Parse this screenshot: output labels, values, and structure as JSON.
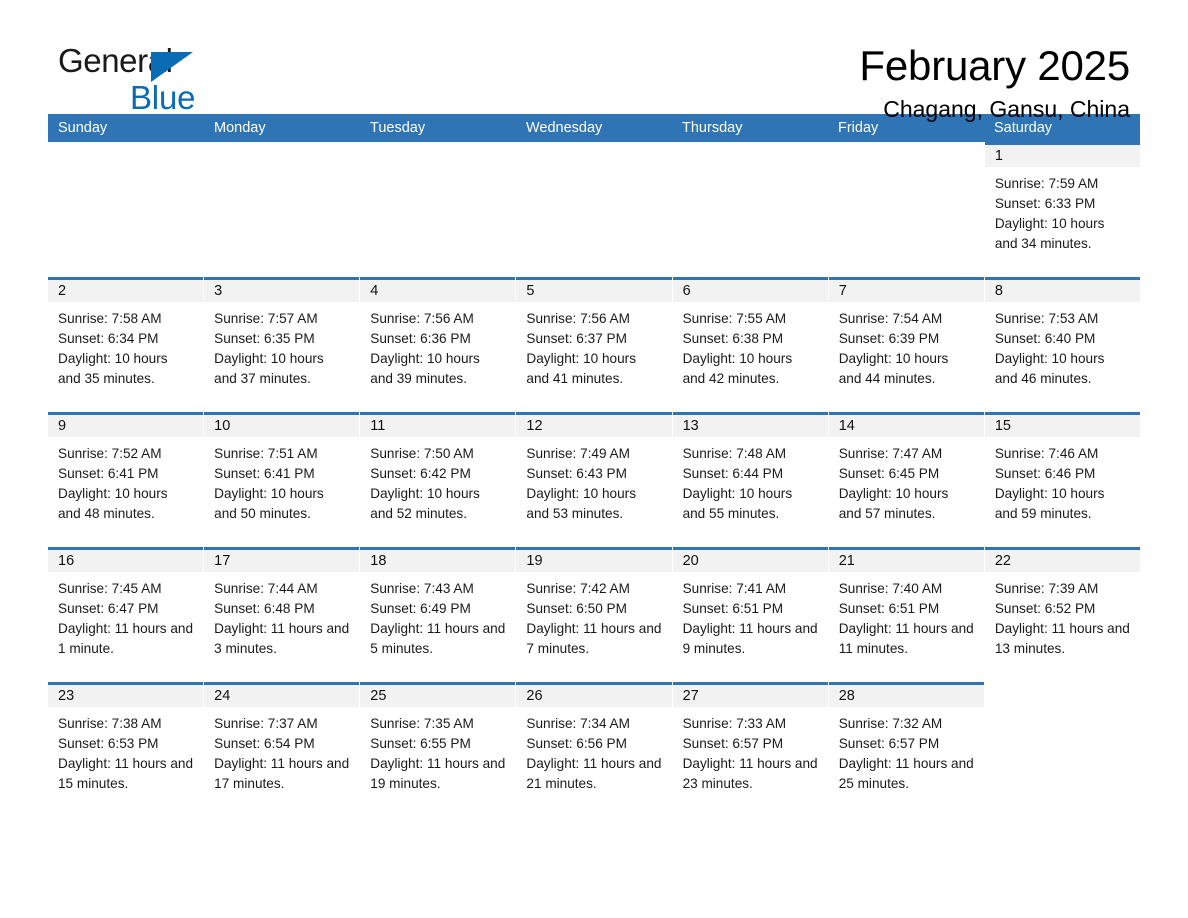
{
  "logo": {
    "word1": "General",
    "word2": "Blue",
    "triangle_color": "#0a6cb4"
  },
  "header": {
    "title": "February 2025",
    "location": "Chagang, Gansu, China"
  },
  "theme": {
    "header_blue": "#2f74b4",
    "daynum_band": "#f2f2f2",
    "text": "#1a1a1a"
  },
  "weekdays": [
    "Sunday",
    "Monday",
    "Tuesday",
    "Wednesday",
    "Thursday",
    "Friday",
    "Saturday"
  ],
  "weeks": [
    [
      {
        "state": "blank"
      },
      {
        "state": "blank"
      },
      {
        "state": "blank"
      },
      {
        "state": "blank"
      },
      {
        "state": "blank"
      },
      {
        "state": "blank"
      },
      {
        "state": "filled",
        "day": "1",
        "sunrise": "Sunrise: 7:59 AM",
        "sunset": "Sunset: 6:33 PM",
        "daylight": "Daylight: 10 hours and 34 minutes."
      }
    ],
    [
      {
        "state": "filled",
        "day": "2",
        "sunrise": "Sunrise: 7:58 AM",
        "sunset": "Sunset: 6:34 PM",
        "daylight": "Daylight: 10 hours and 35 minutes."
      },
      {
        "state": "filled",
        "day": "3",
        "sunrise": "Sunrise: 7:57 AM",
        "sunset": "Sunset: 6:35 PM",
        "daylight": "Daylight: 10 hours and 37 minutes."
      },
      {
        "state": "filled",
        "day": "4",
        "sunrise": "Sunrise: 7:56 AM",
        "sunset": "Sunset: 6:36 PM",
        "daylight": "Daylight: 10 hours and 39 minutes."
      },
      {
        "state": "filled",
        "day": "5",
        "sunrise": "Sunrise: 7:56 AM",
        "sunset": "Sunset: 6:37 PM",
        "daylight": "Daylight: 10 hours and 41 minutes."
      },
      {
        "state": "filled",
        "day": "6",
        "sunrise": "Sunrise: 7:55 AM",
        "sunset": "Sunset: 6:38 PM",
        "daylight": "Daylight: 10 hours and 42 minutes."
      },
      {
        "state": "filled",
        "day": "7",
        "sunrise": "Sunrise: 7:54 AM",
        "sunset": "Sunset: 6:39 PM",
        "daylight": "Daylight: 10 hours and 44 minutes."
      },
      {
        "state": "filled",
        "day": "8",
        "sunrise": "Sunrise: 7:53 AM",
        "sunset": "Sunset: 6:40 PM",
        "daylight": "Daylight: 10 hours and 46 minutes."
      }
    ],
    [
      {
        "state": "filled",
        "day": "9",
        "sunrise": "Sunrise: 7:52 AM",
        "sunset": "Sunset: 6:41 PM",
        "daylight": "Daylight: 10 hours and 48 minutes."
      },
      {
        "state": "filled",
        "day": "10",
        "sunrise": "Sunrise: 7:51 AM",
        "sunset": "Sunset: 6:41 PM",
        "daylight": "Daylight: 10 hours and 50 minutes."
      },
      {
        "state": "filled",
        "day": "11",
        "sunrise": "Sunrise: 7:50 AM",
        "sunset": "Sunset: 6:42 PM",
        "daylight": "Daylight: 10 hours and 52 minutes."
      },
      {
        "state": "filled",
        "day": "12",
        "sunrise": "Sunrise: 7:49 AM",
        "sunset": "Sunset: 6:43 PM",
        "daylight": "Daylight: 10 hours and 53 minutes."
      },
      {
        "state": "filled",
        "day": "13",
        "sunrise": "Sunrise: 7:48 AM",
        "sunset": "Sunset: 6:44 PM",
        "daylight": "Daylight: 10 hours and 55 minutes."
      },
      {
        "state": "filled",
        "day": "14",
        "sunrise": "Sunrise: 7:47 AM",
        "sunset": "Sunset: 6:45 PM",
        "daylight": "Daylight: 10 hours and 57 minutes."
      },
      {
        "state": "filled",
        "day": "15",
        "sunrise": "Sunrise: 7:46 AM",
        "sunset": "Sunset: 6:46 PM",
        "daylight": "Daylight: 10 hours and 59 minutes."
      }
    ],
    [
      {
        "state": "filled",
        "day": "16",
        "sunrise": "Sunrise: 7:45 AM",
        "sunset": "Sunset: 6:47 PM",
        "daylight": "Daylight: 11 hours and 1 minute."
      },
      {
        "state": "filled",
        "day": "17",
        "sunrise": "Sunrise: 7:44 AM",
        "sunset": "Sunset: 6:48 PM",
        "daylight": "Daylight: 11 hours and 3 minutes."
      },
      {
        "state": "filled",
        "day": "18",
        "sunrise": "Sunrise: 7:43 AM",
        "sunset": "Sunset: 6:49 PM",
        "daylight": "Daylight: 11 hours and 5 minutes."
      },
      {
        "state": "filled",
        "day": "19",
        "sunrise": "Sunrise: 7:42 AM",
        "sunset": "Sunset: 6:50 PM",
        "daylight": "Daylight: 11 hours and 7 minutes."
      },
      {
        "state": "filled",
        "day": "20",
        "sunrise": "Sunrise: 7:41 AM",
        "sunset": "Sunset: 6:51 PM",
        "daylight": "Daylight: 11 hours and 9 minutes."
      },
      {
        "state": "filled",
        "day": "21",
        "sunrise": "Sunrise: 7:40 AM",
        "sunset": "Sunset: 6:51 PM",
        "daylight": "Daylight: 11 hours and 11 minutes."
      },
      {
        "state": "filled",
        "day": "22",
        "sunrise": "Sunrise: 7:39 AM",
        "sunset": "Sunset: 6:52 PM",
        "daylight": "Daylight: 11 hours and 13 minutes."
      }
    ],
    [
      {
        "state": "filled",
        "day": "23",
        "sunrise": "Sunrise: 7:38 AM",
        "sunset": "Sunset: 6:53 PM",
        "daylight": "Daylight: 11 hours and 15 minutes."
      },
      {
        "state": "filled",
        "day": "24",
        "sunrise": "Sunrise: 7:37 AM",
        "sunset": "Sunset: 6:54 PM",
        "daylight": "Daylight: 11 hours and 17 minutes."
      },
      {
        "state": "filled",
        "day": "25",
        "sunrise": "Sunrise: 7:35 AM",
        "sunset": "Sunset: 6:55 PM",
        "daylight": "Daylight: 11 hours and 19 minutes."
      },
      {
        "state": "filled",
        "day": "26",
        "sunrise": "Sunrise: 7:34 AM",
        "sunset": "Sunset: 6:56 PM",
        "daylight": "Daylight: 11 hours and 21 minutes."
      },
      {
        "state": "filled",
        "day": "27",
        "sunrise": "Sunrise: 7:33 AM",
        "sunset": "Sunset: 6:57 PM",
        "daylight": "Daylight: 11 hours and 23 minutes."
      },
      {
        "state": "filled",
        "day": "28",
        "sunrise": "Sunrise: 7:32 AM",
        "sunset": "Sunset: 6:57 PM",
        "daylight": "Daylight: 11 hours and 25 minutes."
      },
      {
        "state": "blank"
      }
    ]
  ]
}
